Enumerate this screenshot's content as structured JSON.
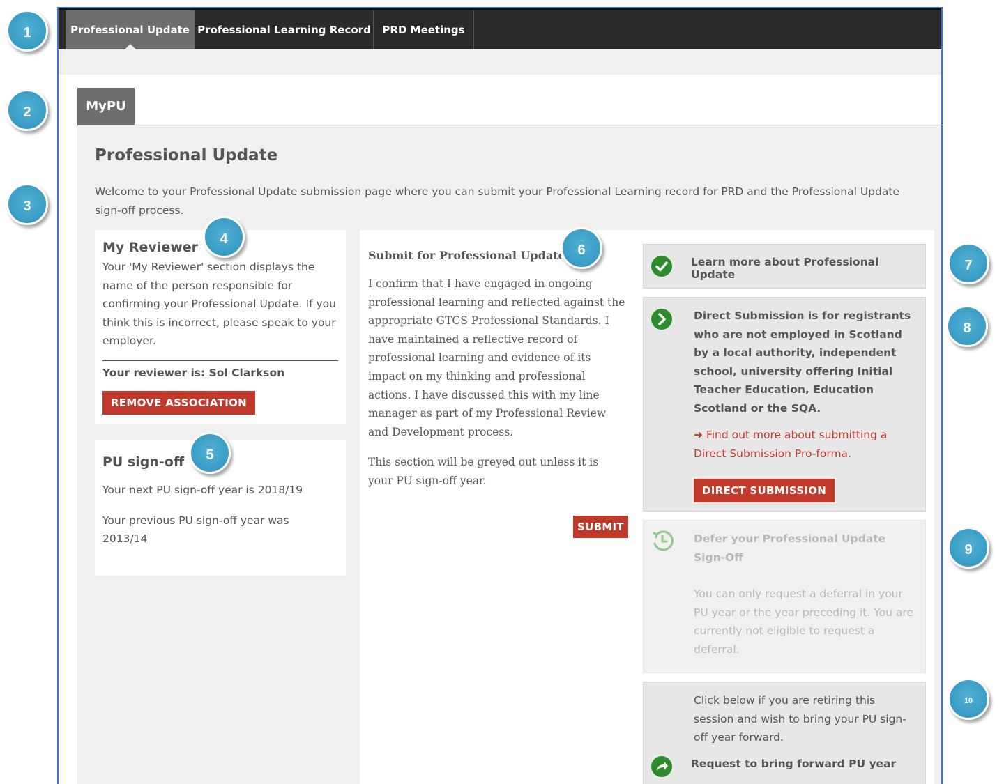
{
  "nav": {
    "tabs": [
      {
        "label": "Professional Update",
        "active": true
      },
      {
        "label": "Professional Learning Record",
        "active": false
      },
      {
        "label": "PRD Meetings",
        "active": false
      }
    ]
  },
  "subtab": {
    "label": "MyPU"
  },
  "page": {
    "title": "Professional Update",
    "intro": "Welcome to your Professional Update submission page where you can submit your Professional Learning record for PRD and the Professional Update sign-off process."
  },
  "reviewer": {
    "title": "My Reviewer",
    "description": "Your 'My Reviewer' section displays the name of the person responsible for confirming your Professional Update. If you think this is incorrect, please speak to your employer.",
    "reviewer_line": "Your reviewer is: Sol Clarkson",
    "remove_button": "REMOVE ASSOCIATION"
  },
  "signoff": {
    "title": "PU sign-off",
    "next_year": "Your next PU sign-off year is 2018/19",
    "previous_year": "Your previous PU sign-off year was 2013/14"
  },
  "submit": {
    "title": "Submit for Professional Update",
    "confirmation": "I confirm that I have engaged in ongoing professional learning and reflected against the appropriate GTCS Professional Standards. I have maintained a reflective record of professional learning and evidence of its impact on my thinking and professional actions. I have discussed this with my line manager as part of my Professional Review and Development process.",
    "note": "This section will be greyed out unless it is your PU sign-off year.",
    "button": "SUBMIT"
  },
  "sidebar": {
    "learn_more": "Learn more about Professional Update",
    "direct": {
      "text": "Direct Submission is for registrants who are not employed in Scotland by a local authority, independent school, university offering Initial Teacher Education, Education Scotland or the SQA.",
      "link": "Find out more about submitting a Direct Submission Pro-forma.",
      "button": "DIRECT SUBMISSION"
    },
    "defer": {
      "title": "Defer your Professional Update Sign-Off",
      "text": "You can only request a deferral in your PU year or the year preceding it. You are currently not eligible to request a deferral."
    },
    "forward": {
      "text": "Click below if you are retiring this session and wish to bring your PU sign-off year forward.",
      "action": "Request to bring forward PU year"
    }
  },
  "callouts": [
    "1",
    "2",
    "3",
    "4",
    "5",
    "6",
    "7",
    "8",
    "9",
    "10"
  ],
  "colors": {
    "accent_red": "#c0392b",
    "green": "#2e8b2e",
    "nav_bg": "#2a2a2a",
    "callout_blue": "#3a9dc5"
  }
}
